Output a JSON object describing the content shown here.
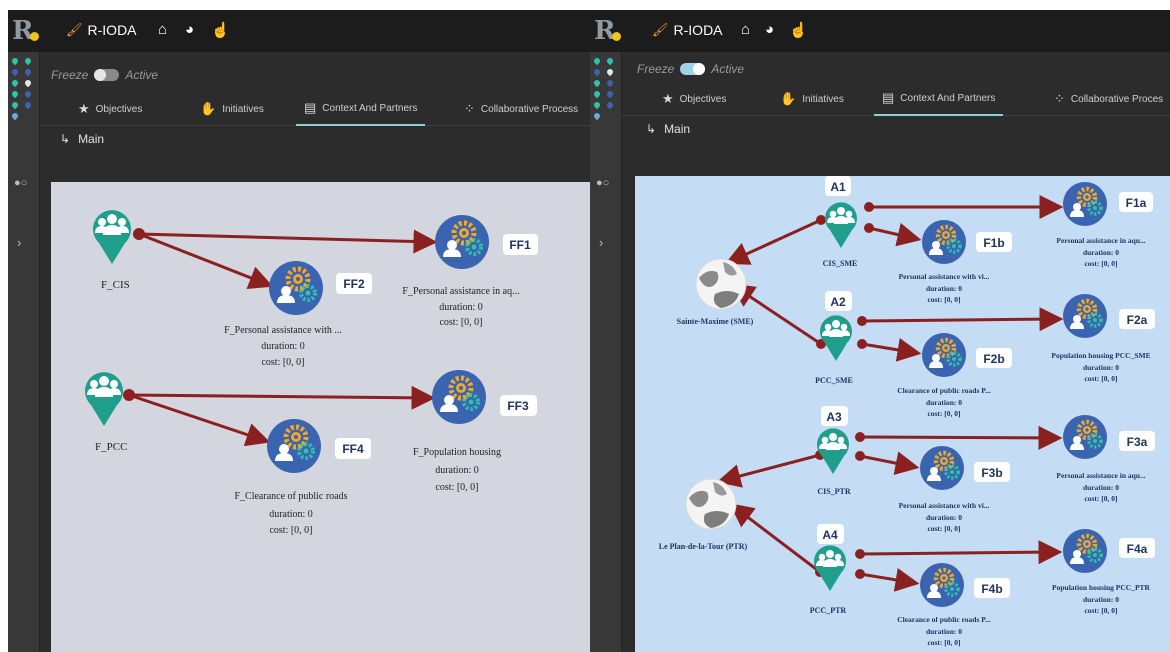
{
  "app": {
    "name": "R-IODA",
    "logo": "R"
  },
  "toolbar": {
    "icons": [
      "home-icon",
      "palette-icon",
      "user-touch-icon"
    ]
  },
  "freeze": {
    "label": "Freeze",
    "state_label": "Active"
  },
  "tabs": [
    {
      "label": "Objectives",
      "icon": "star-icon"
    },
    {
      "label": "Initiatives",
      "icon": "thumbs-up-icon"
    },
    {
      "label": "Context And Partners",
      "icon": "store-icon",
      "active": true
    },
    {
      "label": "Collaborative Process",
      "icon": "network-icon"
    }
  ],
  "left_panel": {
    "tab4_label": "Collaborative Process",
    "breadcrumb": "Main",
    "freeze_on": false,
    "graph": {
      "partners": [
        {
          "name": "F_CIS"
        },
        {
          "name": "F_PCC"
        }
      ],
      "functions": [
        {
          "tag": "FF1",
          "name": "F_Personal assistance in aq...",
          "duration": "duration: 0",
          "cost": "cost: [0, 0]"
        },
        {
          "tag": "FF2",
          "name": "F_Personal assistance with ...",
          "duration": "duration: 0",
          "cost": "cost: [0, 0]"
        },
        {
          "tag": "FF3",
          "name": "F_Population housing",
          "duration": "duration: 0",
          "cost": "cost: [0, 0]"
        },
        {
          "tag": "FF4",
          "name": "F_Clearance of public roads",
          "duration": "duration: 0",
          "cost": "cost: [0, 0]"
        }
      ]
    }
  },
  "right_panel": {
    "tab4_label": "Collaborative Proces",
    "breadcrumb": "Main",
    "freeze_on": true,
    "graph": {
      "entities": [
        {
          "name": "Sainte-Maxime (SME)"
        },
        {
          "name": "Le Plan-de-la-Tour (PTR)"
        }
      ],
      "partners": [
        {
          "tag": "A1",
          "name": "CIS_SME"
        },
        {
          "tag": "A2",
          "name": "PCC_SME"
        },
        {
          "tag": "A3",
          "name": "CIS_PTR"
        },
        {
          "tag": "A4",
          "name": "PCC_PTR"
        }
      ],
      "functions": [
        {
          "tag": "F1a",
          "name": "Personal assistance in aqu...",
          "duration": "duration: 0",
          "cost": "cost: [0, 0]"
        },
        {
          "tag": "F1b",
          "name": "Personal assistance with vi...",
          "duration": "duration: 0",
          "cost": "cost: [0, 0]"
        },
        {
          "tag": "F2a",
          "name": "Population housing PCC_SME",
          "duration": "duration: 0",
          "cost": "cost: [0, 0]"
        },
        {
          "tag": "F2b",
          "name": "Clearance of public roads P...",
          "duration": "duration: 0",
          "cost": "cost: [0, 0]"
        },
        {
          "tag": "F3a",
          "name": "Personal assistance in aqu...",
          "duration": "duration: 0",
          "cost": "cost: [0, 0]"
        },
        {
          "tag": "F3b",
          "name": "Personal assistance with vi...",
          "duration": "duration: 0",
          "cost": "cost: [0, 0]"
        },
        {
          "tag": "F4a",
          "name": "Population housing PCC_PTR",
          "duration": "duration: 0",
          "cost": "cost: [0, 0]"
        },
        {
          "tag": "F4b",
          "name": "Clearance of public roads P...",
          "duration": "duration: 0",
          "cost": "cost: [0, 0]"
        }
      ]
    }
  },
  "colors": {
    "edge": "#8b2020",
    "partner": "#1f9e8c",
    "function_bg": "#3a63b0",
    "gear": "#f3a825",
    "gear2": "#2ec4a8",
    "tag_bg": "#ffffff",
    "tag_text": "#1f3560"
  }
}
